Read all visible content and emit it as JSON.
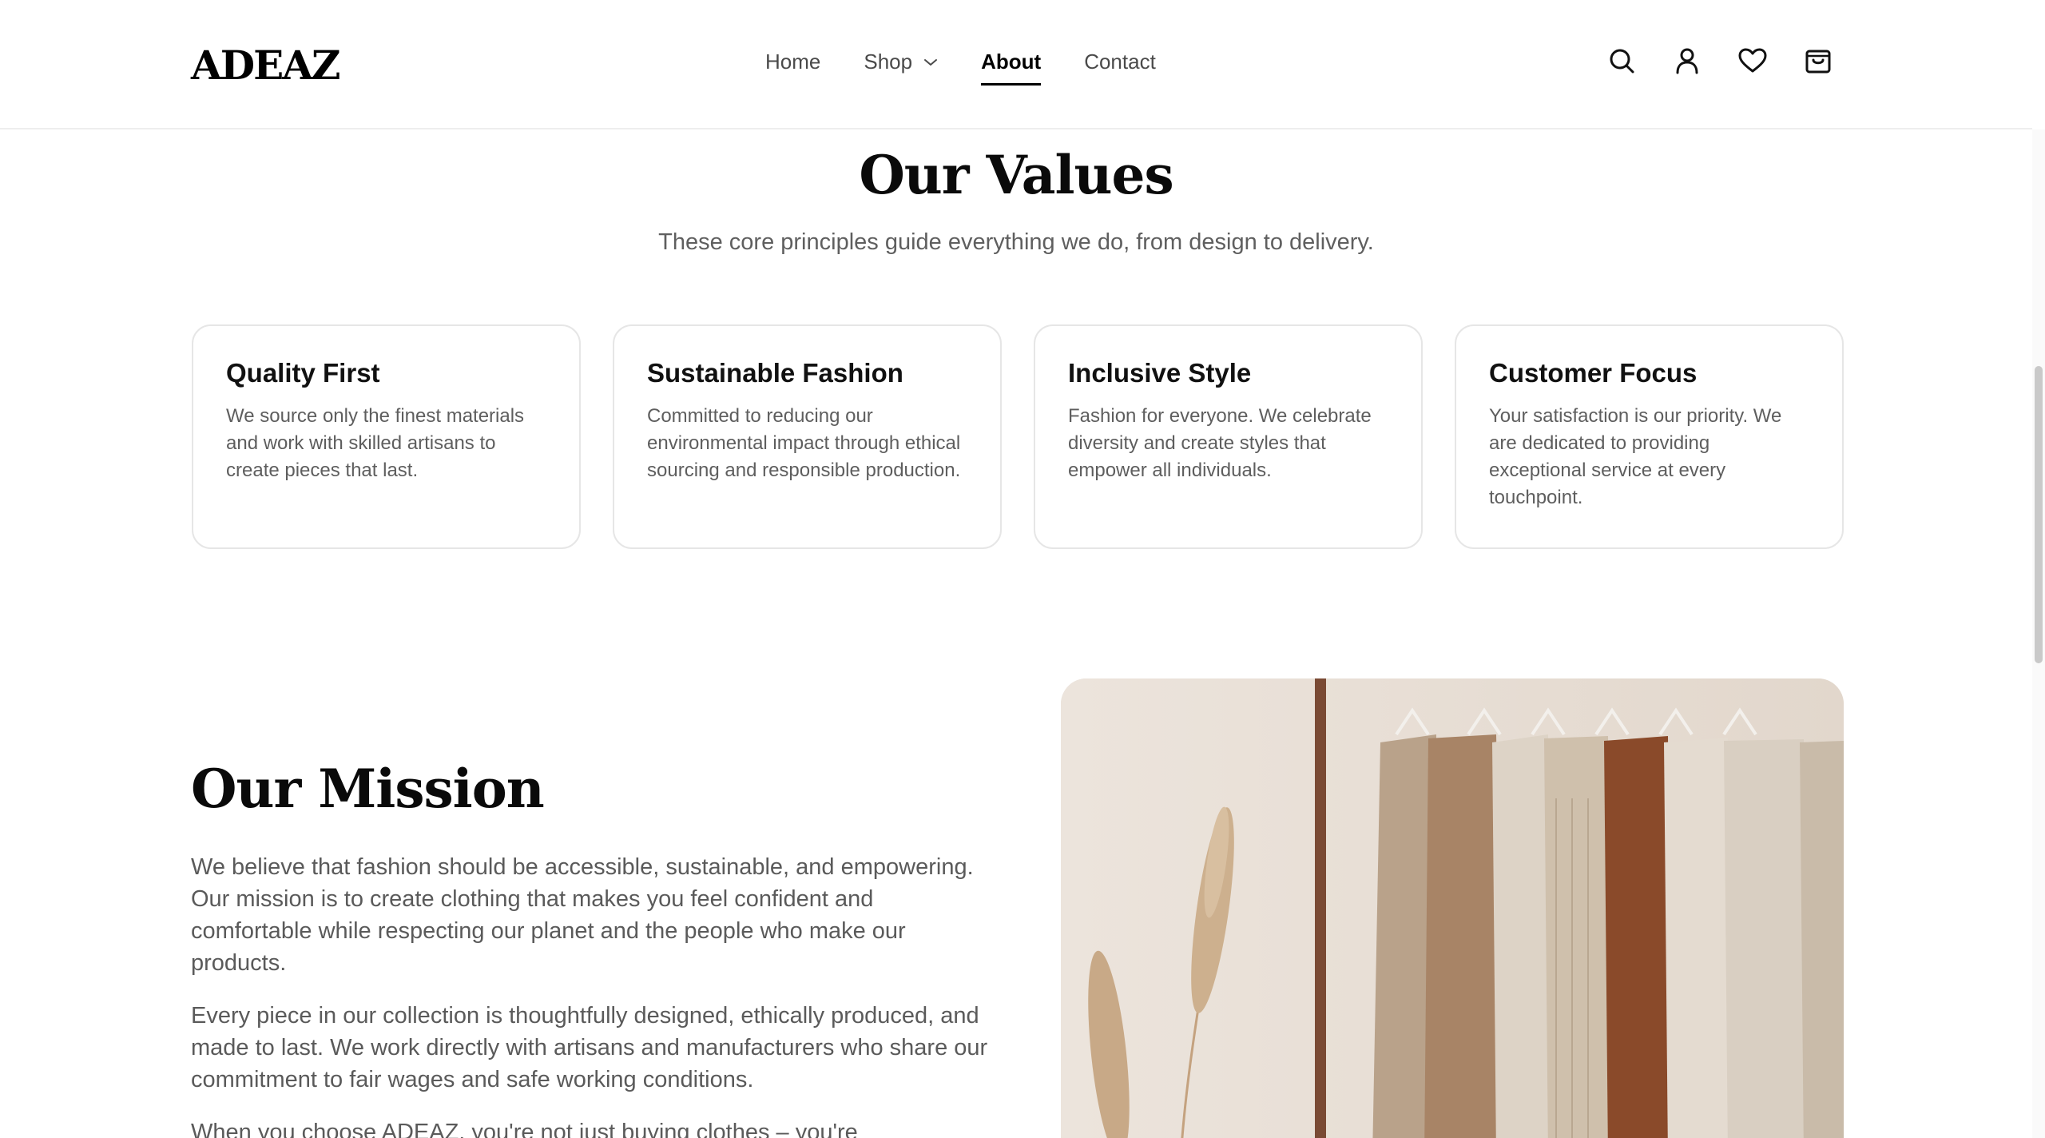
{
  "header": {
    "logo": "ADEAZ",
    "nav": [
      {
        "label": "Home"
      },
      {
        "label": "Shop"
      },
      {
        "label": "About"
      },
      {
        "label": "Contact"
      }
    ],
    "active_nav": "About",
    "icons": [
      "search-icon",
      "user-icon",
      "heart-icon",
      "bag-icon"
    ]
  },
  "values": {
    "title": "Our Values",
    "subtitle": "These core principles guide everything we do, from design to delivery.",
    "cards": [
      {
        "title": "Quality First",
        "text": "We source only the finest materials and work with skilled artisans to create pieces that last."
      },
      {
        "title": "Sustainable Fashion",
        "text": "Committed to reducing our environmental impact through ethical sourcing and responsible production."
      },
      {
        "title": "Inclusive Style",
        "text": "Fashion for everyone. We celebrate diversity and create styles that empower all individuals."
      },
      {
        "title": "Customer Focus",
        "text": "Your satisfaction is our priority. We are dedicated to providing exceptional service at every touchpoint."
      }
    ]
  },
  "mission": {
    "title": "Our Mission",
    "paragraphs": [
      "We believe that fashion should be accessible, sustainable, and empowering. Our mission is to create clothing that makes you feel confident and comfortable while respecting our planet and the people who make our products.",
      "Every piece in our collection is thoughtfully designed, ethically produced, and made to last. We work directly with artisans and manufacturers who share our commitment to fair wages and safe working conditions.",
      "When you choose ADEAZ, you're not just buying clothes – you're"
    ]
  },
  "colors": {
    "text": "#111111",
    "muted": "#5e5e5e",
    "border": "#e6e6e6",
    "image_bg": "#e8dfd7"
  }
}
